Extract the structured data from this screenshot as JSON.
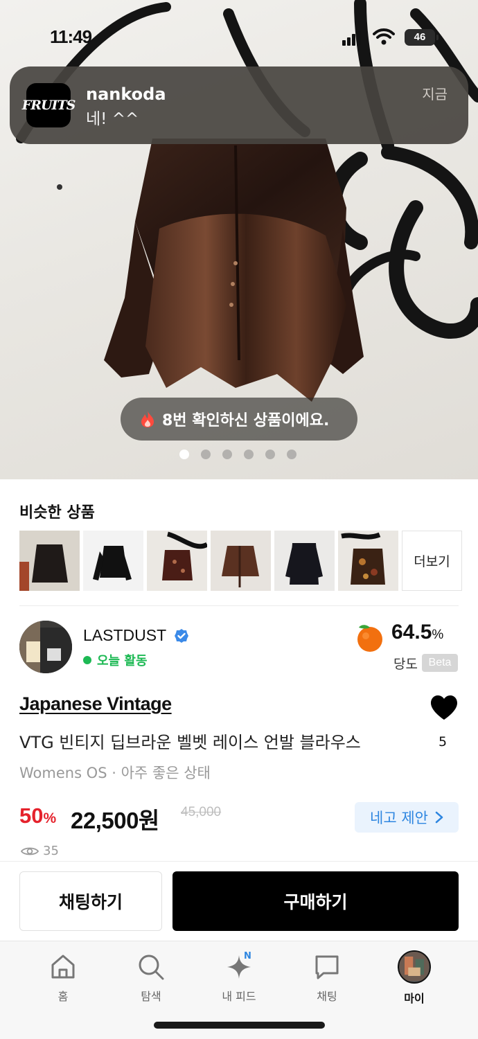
{
  "status_bar": {
    "time": "11:49",
    "battery": "46"
  },
  "notification": {
    "app_icon_text": "FRUITS",
    "title": "nankoda",
    "body": "네! ^^",
    "time": "지금"
  },
  "hero": {
    "viewed_text": "8번 확인하신 상품이에요.",
    "image_count": 6,
    "active_image_index": 0
  },
  "similar": {
    "title": "비슷한 상품",
    "more_label": "더보기"
  },
  "seller": {
    "name": "LASTDUST",
    "activity": "오늘 활동",
    "temperature": "64.5",
    "temperature_unit": "%",
    "temperature_label": "당도",
    "beta_label": "Beta"
  },
  "product": {
    "brand": "Japanese Vintage",
    "title": "VTG 빈티지 딥브라운 벨벳 레이스 언발 블라우스",
    "meta": "Womens OS · 아주 좋은 상태",
    "like_count": "5",
    "discount": "50",
    "discount_unit": "%",
    "price": "22,500원",
    "original_price": "45,000",
    "offer_label": "네고 제안",
    "views": "35"
  },
  "actions": {
    "chat_label": "채팅하기",
    "buy_label": "구매하기"
  },
  "tabbar": {
    "items": [
      {
        "label": "홈"
      },
      {
        "label": "탐색"
      },
      {
        "label": "내 피드",
        "badge": "N"
      },
      {
        "label": "채팅"
      },
      {
        "label": "마이"
      }
    ]
  },
  "colors": {
    "accent_blue": "#2e86e0",
    "discount_red": "#e5222c",
    "active_green": "#1db954",
    "buy_black": "#000000"
  }
}
